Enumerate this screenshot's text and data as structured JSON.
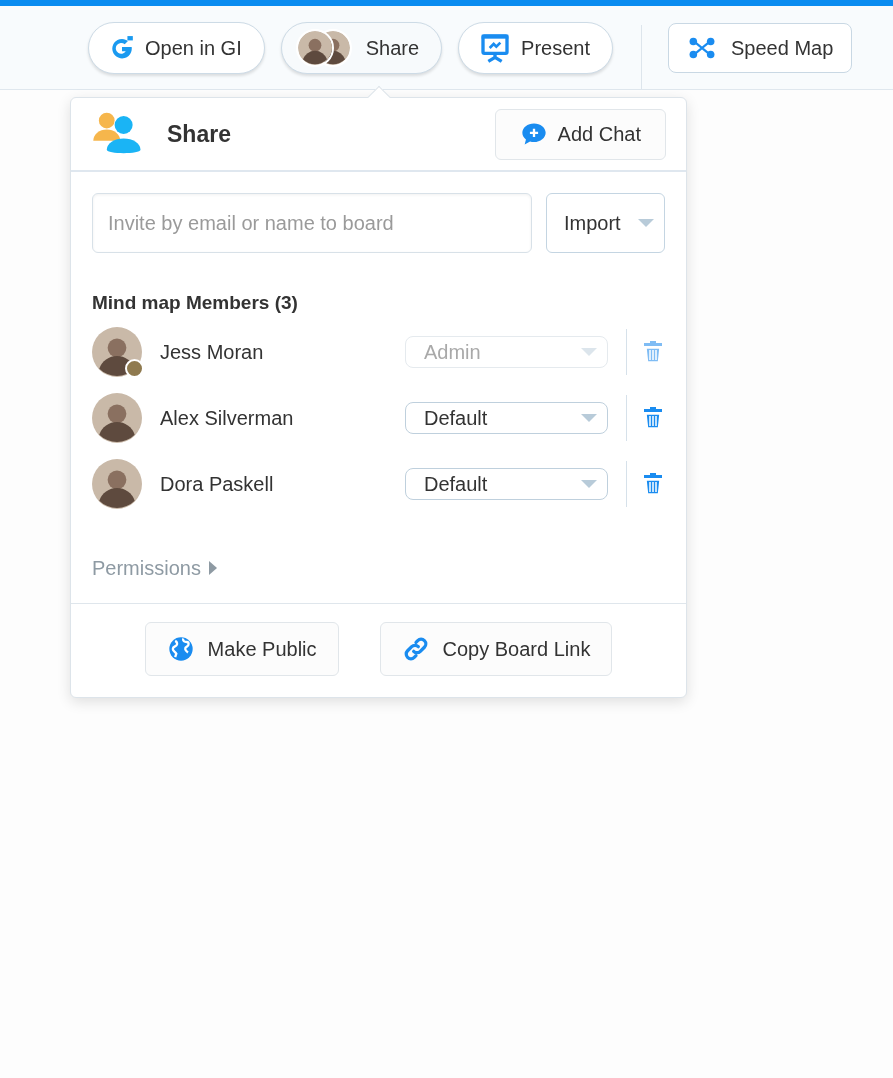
{
  "toolbar": {
    "buttons": [
      {
        "kind": "gi",
        "label": "Open in GI"
      },
      {
        "kind": "share",
        "label": "Share",
        "selected": true
      },
      {
        "kind": "present",
        "label": "Present"
      }
    ],
    "speed_map": {
      "label": "Speed Map"
    }
  },
  "share_panel": {
    "title": "Share",
    "add_chat": "Add Chat",
    "invite": {
      "placeholder": "Invite by email or name to board"
    },
    "import": "Import",
    "members_heading": "Mind map Members (3)",
    "members": [
      {
        "name": "Jess Moran",
        "role": "Admin",
        "disabled": true,
        "badge": true
      },
      {
        "name": "Alex Silverman",
        "role": "Default",
        "disabled": false,
        "badge": false
      },
      {
        "name": "Dora Paskell",
        "role": "Default",
        "disabled": false,
        "badge": false
      }
    ],
    "permissions": {
      "label": "Permissions",
      "expanded": false
    },
    "footer_buttons": [
      {
        "kind": "public",
        "label": "Make Public"
      },
      {
        "kind": "link",
        "label": "Copy Board Link"
      }
    ]
  }
}
